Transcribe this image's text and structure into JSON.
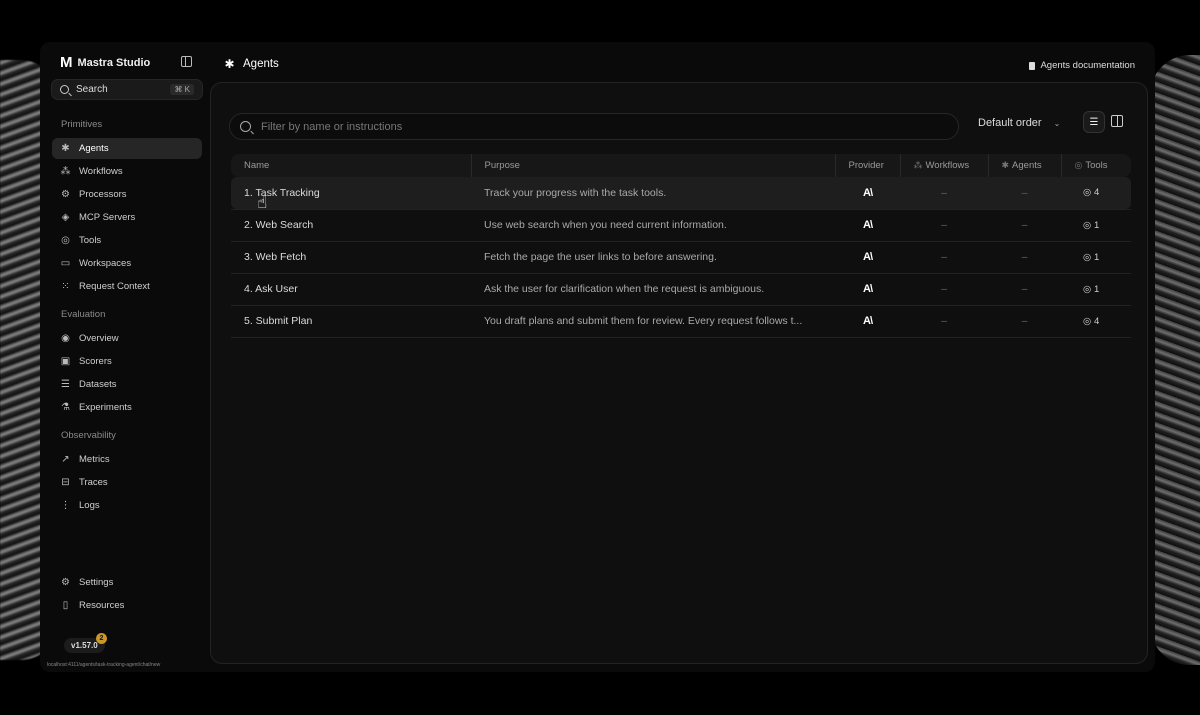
{
  "sidebar": {
    "brand": "Mastra Studio",
    "search": {
      "label": "Search",
      "shortcut": "⌘ K"
    },
    "sections": {
      "primitives": "Primitives",
      "evaluation": "Evaluation",
      "observability": "Observability"
    },
    "items": {
      "agents": "Agents",
      "workflows": "Workflows",
      "processors": "Processors",
      "mcp": "MCP Servers",
      "tools": "Tools",
      "workspaces": "Workspaces",
      "request_context": "Request Context",
      "overview": "Overview",
      "scorers": "Scorers",
      "datasets": "Datasets",
      "experiments": "Experiments",
      "metrics": "Metrics",
      "traces": "Traces",
      "logs": "Logs",
      "settings": "Settings",
      "resources": "Resources"
    },
    "version": "v1.57.0",
    "update_count": "2",
    "url": "localhost:4111/agents/task-tracking-agent/chat/new"
  },
  "header": {
    "title": "Agents",
    "doc_link": "Agents documentation"
  },
  "toolbar": {
    "filter_placeholder": "Filter by name or instructions",
    "order": "Default order"
  },
  "table": {
    "columns": {
      "name": "Name",
      "purpose": "Purpose",
      "provider": "Provider",
      "workflows": "Workflows",
      "agents": "Agents",
      "tools": "Tools"
    },
    "rows": [
      {
        "name": "1. Task Tracking",
        "purpose": "Track your progress with the task tools.",
        "provider": "A\\",
        "workflows": "–",
        "agents": "–",
        "tools": "4"
      },
      {
        "name": "2. Web Search",
        "purpose": "Use web search when you need current information.",
        "provider": "A\\",
        "workflows": "–",
        "agents": "–",
        "tools": "1"
      },
      {
        "name": "3. Web Fetch",
        "purpose": "Fetch the page the user links to before answering.",
        "provider": "A\\",
        "workflows": "–",
        "agents": "–",
        "tools": "1"
      },
      {
        "name": "4. Ask User",
        "purpose": "Ask the user for clarification when the request is ambiguous.",
        "provider": "A\\",
        "workflows": "–",
        "agents": "–",
        "tools": "1"
      },
      {
        "name": "5. Submit Plan",
        "purpose": "You draft plans and submit them for review. Every request follows t...",
        "provider": "A\\",
        "workflows": "–",
        "agents": "–",
        "tools": "4"
      }
    ]
  }
}
